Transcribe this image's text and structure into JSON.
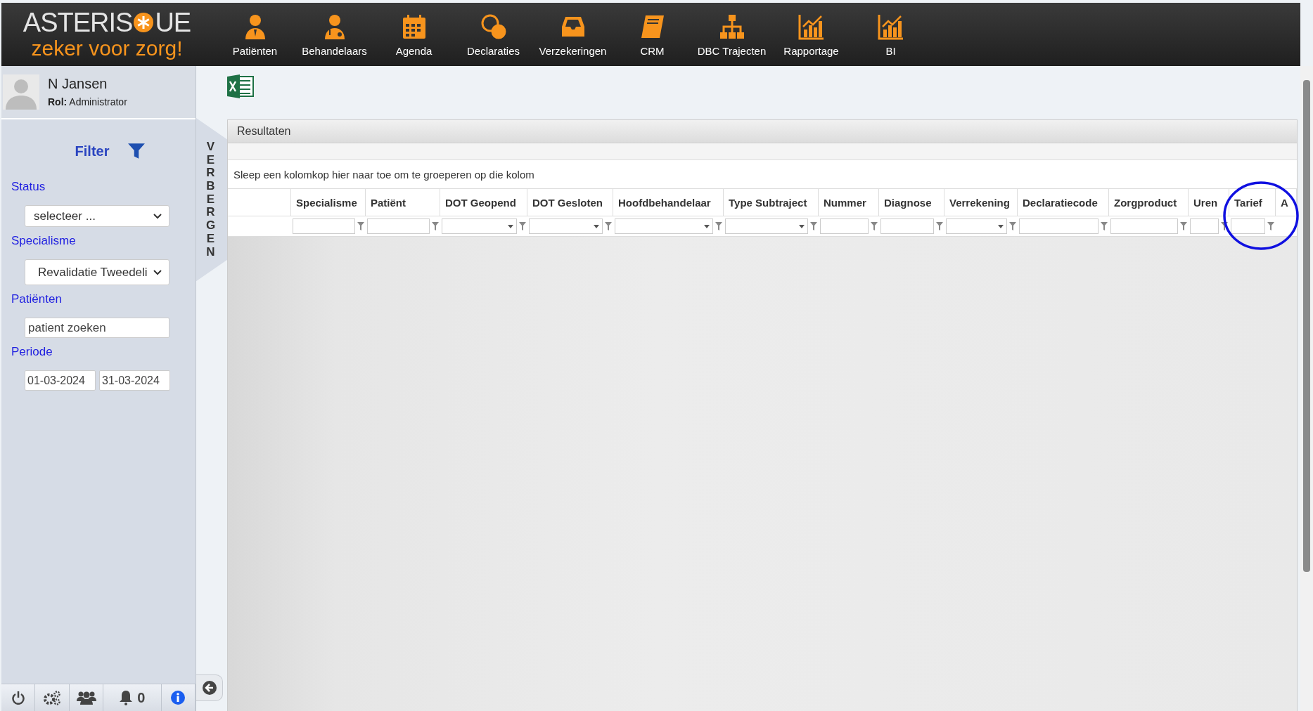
{
  "logo": {
    "word_left": "ASTERIS",
    "word_right": "UE",
    "tagline": "zeker voor zorg!"
  },
  "nav": [
    {
      "label": "Patiënten"
    },
    {
      "label": "Behandelaars"
    },
    {
      "label": "Agenda"
    },
    {
      "label": "Declaraties"
    },
    {
      "label": "Verzekeringen"
    },
    {
      "label": "CRM"
    },
    {
      "label": "DBC Trajecten"
    },
    {
      "label": "Rapportage"
    },
    {
      "label": "BI"
    }
  ],
  "user": {
    "name": "N Jansen",
    "role": "**Rol:** Administrator"
  },
  "filter": {
    "title": "Filter",
    "fields": [
      {
        "kind": "select",
        "label": "Status",
        "value": "selecteer ..."
      },
      {
        "kind": "select",
        "label": "Specialisme",
        "value": "Revalidatie Tweedeli"
      },
      {
        "kind": "input",
        "label": "Patiënten",
        "placeholder": "patient zoeken"
      },
      {
        "kind": "daterange",
        "label": "Periode",
        "from": "01-03-2024",
        "to": "31-03-2024"
      }
    ]
  },
  "hide_tab": "VERBERGEN",
  "toolbar": {
    "notification_count": "0"
  },
  "results": {
    "title": "Resultaten",
    "group_hint": "Sleep een kolomkop hier naar toe om te groeperen op die kolom",
    "columns": [
      {
        "kind": "blank"
      },
      {
        "label": "Specialisme",
        "kind": "text"
      },
      {
        "label": "Patiënt",
        "kind": "text"
      },
      {
        "label": "DOT Geopend",
        "kind": "select"
      },
      {
        "label": "DOT Gesloten",
        "kind": "select"
      },
      {
        "label": "Hoofdbehandelaar",
        "kind": "select"
      },
      {
        "label": "Type Subtraject",
        "kind": "select"
      },
      {
        "label": "Nummer",
        "kind": "text"
      },
      {
        "label": "Diagnose",
        "kind": "text"
      },
      {
        "label": "Verrekening",
        "kind": "select"
      },
      {
        "label": "Declaratiecode",
        "kind": "text"
      },
      {
        "label": "Zorgproduct",
        "kind": "text"
      },
      {
        "label": "Uren",
        "kind": "text"
      },
      {
        "label": "Tarief",
        "kind": "text"
      },
      {
        "label": "A",
        "kind": "cut"
      }
    ]
  }
}
